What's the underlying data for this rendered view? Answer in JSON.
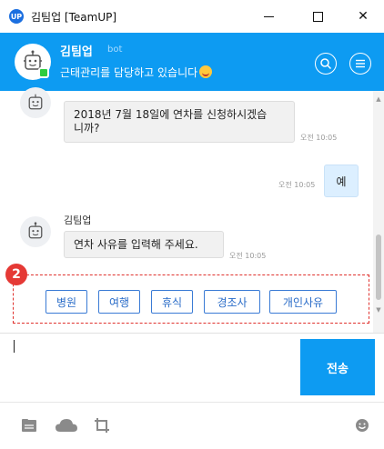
{
  "window": {
    "title": "김팀업 [TeamUP]",
    "logo_text": "UP",
    "minimize_icon": "minimize-icon",
    "maximize_icon": "maximize-icon",
    "close_label": "✕"
  },
  "header": {
    "name": "김팀업",
    "tag": "bot",
    "status": "근태관리를 담당하고 있습니다",
    "status_emoji": "smile-emoji",
    "accent_color": "#0d9bf2"
  },
  "messages": [
    {
      "from": "bot",
      "sender": "",
      "text_line1": "2018년 7월 18일에 연차를 신청하시겠습",
      "text_line2": "니까?",
      "time": "오전 10:05"
    },
    {
      "from": "me",
      "text": "예",
      "time": "오전 10:05"
    },
    {
      "from": "bot",
      "sender": "김팀업",
      "text": "연차 사유를 입력해 주세요.",
      "time": "오전 10:05"
    }
  ],
  "step_badge": "2",
  "choices": [
    "병원",
    "여행",
    "휴식",
    "경조사",
    "개인사유"
  ],
  "composer": {
    "value": "",
    "send_label": "전송"
  },
  "toolbar": {
    "icons": [
      "file-icon",
      "cloud-icon",
      "crop-icon",
      "emoji-icon"
    ]
  }
}
